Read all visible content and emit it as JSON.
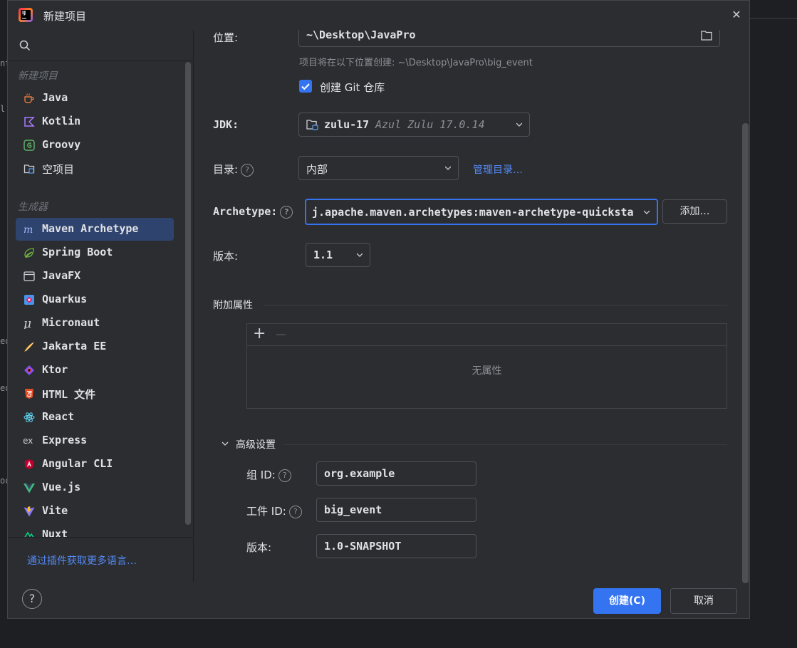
{
  "window": {
    "title": "新建项目"
  },
  "background": {
    "fragments": [
      "nt",
      "l",
      "ed",
      "ed",
      "oo"
    ]
  },
  "sidebar": {
    "section_new": "新建项目",
    "new_items": [
      {
        "label": "Java",
        "icon": "java-cup-icon"
      },
      {
        "label": "Kotlin",
        "icon": "kotlin-icon"
      },
      {
        "label": "Groovy",
        "icon": "groovy-icon"
      },
      {
        "label": "空项目",
        "icon": "empty-project-icon"
      }
    ],
    "section_generators": "生成器",
    "generator_items": [
      {
        "label": "Maven Archetype",
        "icon": "maven-icon",
        "selected": true
      },
      {
        "label": "Spring Boot",
        "icon": "spring-boot-icon"
      },
      {
        "label": "JavaFX",
        "icon": "javafx-window-icon"
      },
      {
        "label": "Quarkus",
        "icon": "quarkus-icon"
      },
      {
        "label": "Micronaut",
        "icon": "micronaut-icon"
      },
      {
        "label": "Jakarta EE",
        "icon": "jakarta-ee-icon"
      },
      {
        "label": "Ktor",
        "icon": "ktor-icon"
      },
      {
        "label": "HTML 文件",
        "icon": "html5-icon"
      },
      {
        "label": "React",
        "icon": "react-icon"
      },
      {
        "label": "Express",
        "icon": "express-icon"
      },
      {
        "label": "Angular CLI",
        "icon": "angular-icon"
      },
      {
        "label": "Vue.js",
        "icon": "vue-icon"
      },
      {
        "label": "Vite",
        "icon": "vite-icon"
      },
      {
        "label": "Nuxt",
        "icon": "nuxt-icon"
      }
    ],
    "more_link": "通过插件获取更多语言…"
  },
  "form": {
    "location_label": "位置:",
    "location_value": "~\\Desktop\\JavaPro",
    "location_hint": "项目将在以下位置创建: ~\\Desktop\\JavaPro\\big_event",
    "git_label": "创建 Git 仓库",
    "git_checked": true,
    "jdk_label": "JDK:",
    "jdk_name": "zulu-17",
    "jdk_version": "Azul Zulu 17.0.14",
    "catalog_label": "目录:",
    "catalog_value": "内部",
    "catalog_manage_link": "管理目录…",
    "archetype_label": "Archetype:",
    "archetype_value": "j.apache.maven.archetypes:maven-archetype-quicksta",
    "archetype_add_button": "添加…",
    "version_label": "版本:",
    "version_value": "1.1",
    "extra_props_label": "附加属性",
    "extra_props_add": "+",
    "extra_props_remove": "—",
    "extra_props_empty": "无属性",
    "advanced_label": "高级设置",
    "group_id_label": "组 ID:",
    "group_id_value": "org.example",
    "artifact_id_label": "工件 ID:",
    "artifact_id_value": "big_event",
    "adv_version_label": "版本:",
    "adv_version_value": "1.0-SNAPSHOT"
  },
  "footer": {
    "help": "?",
    "create_button": "创建(C)",
    "cancel_button": "取消"
  },
  "colors": {
    "accent": "#3574f0",
    "link": "#548af7",
    "selection": "#2e436e",
    "background": "#2b2d30"
  }
}
